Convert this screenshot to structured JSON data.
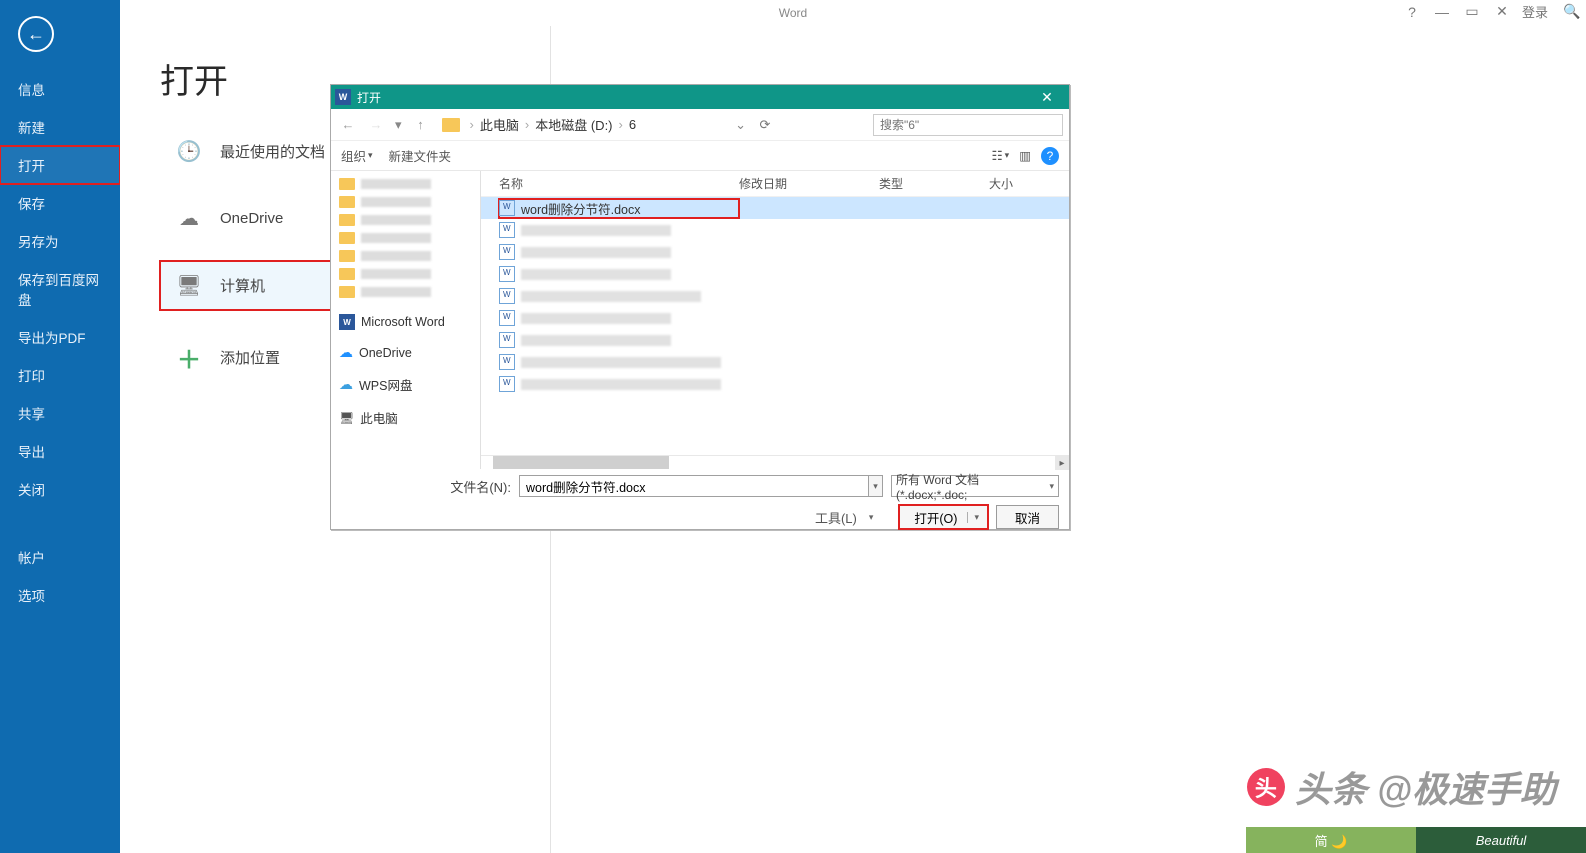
{
  "app": {
    "title": "Word",
    "login": "登录"
  },
  "sidebar": {
    "items": [
      {
        "label": "信息"
      },
      {
        "label": "新建"
      },
      {
        "label": "打开"
      },
      {
        "label": "保存"
      },
      {
        "label": "另存为"
      },
      {
        "label": "保存到百度网盘"
      },
      {
        "label": "导出为PDF"
      },
      {
        "label": "打印"
      },
      {
        "label": "共享"
      },
      {
        "label": "导出"
      },
      {
        "label": "关闭"
      },
      {
        "label": "帐户"
      },
      {
        "label": "选项"
      }
    ]
  },
  "page": {
    "title": "打开"
  },
  "locations": {
    "recent": "最近使用的文档",
    "onedrive": "OneDrive",
    "computer": "计算机",
    "add": "添加位置"
  },
  "dialog": {
    "title": "打开",
    "breadcrumb": [
      "此电脑",
      "本地磁盘 (D:)",
      "6"
    ],
    "search_placeholder": "搜索\"6\"",
    "toolbar": {
      "organize": "组织",
      "newfolder": "新建文件夹"
    },
    "columns": {
      "name": "名称",
      "date": "修改日期",
      "type": "类型",
      "size": "大小"
    },
    "selected_file": "word删除分节符.docx",
    "tree": {
      "msword": "Microsoft Word",
      "onedrive": "OneDrive",
      "wps": "WPS网盘",
      "thispc": "此电脑"
    },
    "footer": {
      "filename_label": "文件名(N):",
      "filename_value": "word删除分节符.docx",
      "filter": "所有 Word 文档(*.docx;*.doc;",
      "tools": "工具(L)",
      "open_btn": "打开(O)",
      "cancel_btn": "取消"
    }
  },
  "watermark": {
    "text": "头条 @极速手助"
  },
  "bottom": {
    "left_pill": "简  🌙",
    "right_pill": "Beautiful"
  }
}
